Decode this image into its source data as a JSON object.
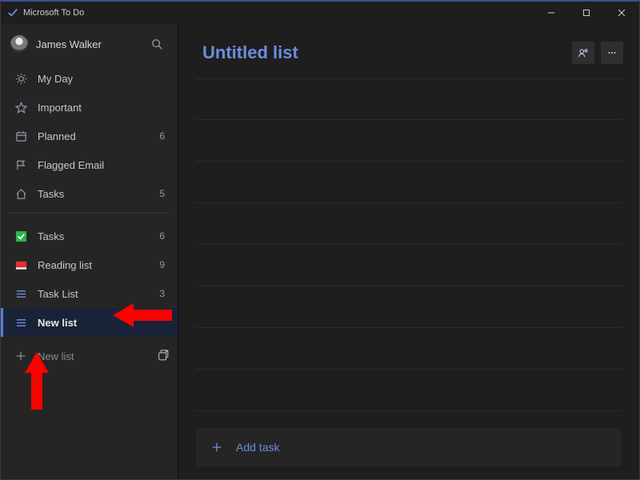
{
  "app_title": "Microsoft To Do",
  "user": {
    "name": "James Walker"
  },
  "sidebar": {
    "smart_lists": [
      {
        "id": "myday",
        "label": "My Day",
        "count": "",
        "icon": "sun-icon"
      },
      {
        "id": "important",
        "label": "Important",
        "count": "",
        "icon": "star-icon"
      },
      {
        "id": "planned",
        "label": "Planned",
        "count": "6",
        "icon": "calendar-icon"
      },
      {
        "id": "flagged",
        "label": "Flagged Email",
        "count": "",
        "icon": "flag-icon"
      },
      {
        "id": "tasks",
        "label": "Tasks",
        "count": "5",
        "icon": "home-icon"
      }
    ],
    "user_lists": [
      {
        "id": "tasks2",
        "label": "Tasks",
        "count": "6",
        "icon": "checkbox-green-icon"
      },
      {
        "id": "reading",
        "label": "Reading list",
        "count": "9",
        "icon": "square-red-icon"
      },
      {
        "id": "tasklist",
        "label": "Task List",
        "count": "3",
        "icon": "list-icon"
      },
      {
        "id": "newlist",
        "label": "New list",
        "count": "",
        "icon": "list-icon",
        "selected": true
      }
    ],
    "new_list_label": "New list"
  },
  "main": {
    "title": "Untitled list",
    "add_task_label": "Add task"
  },
  "colors": {
    "accent": "#6e8de0",
    "arrow": "#ff0000"
  }
}
